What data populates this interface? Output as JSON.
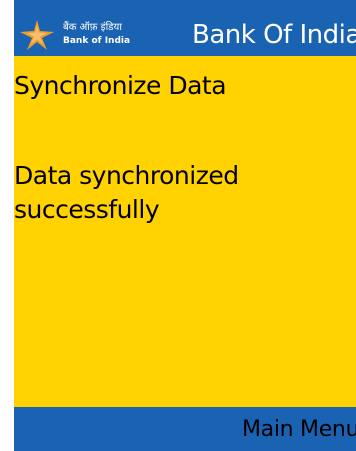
{
  "header": {
    "logo_hindi_text": "बैंक ऑफ़ इंडिया",
    "logo_english_text": "Bank of India",
    "title": "Bank Of India",
    "background_color": "#1a63b2",
    "star_color": "#f29b21"
  },
  "screen": {
    "background_color": "#ffd200",
    "title": "Synchronize Data",
    "message": "Data synchronized successfully"
  },
  "softkeys": {
    "right_label": "Main Menu"
  }
}
